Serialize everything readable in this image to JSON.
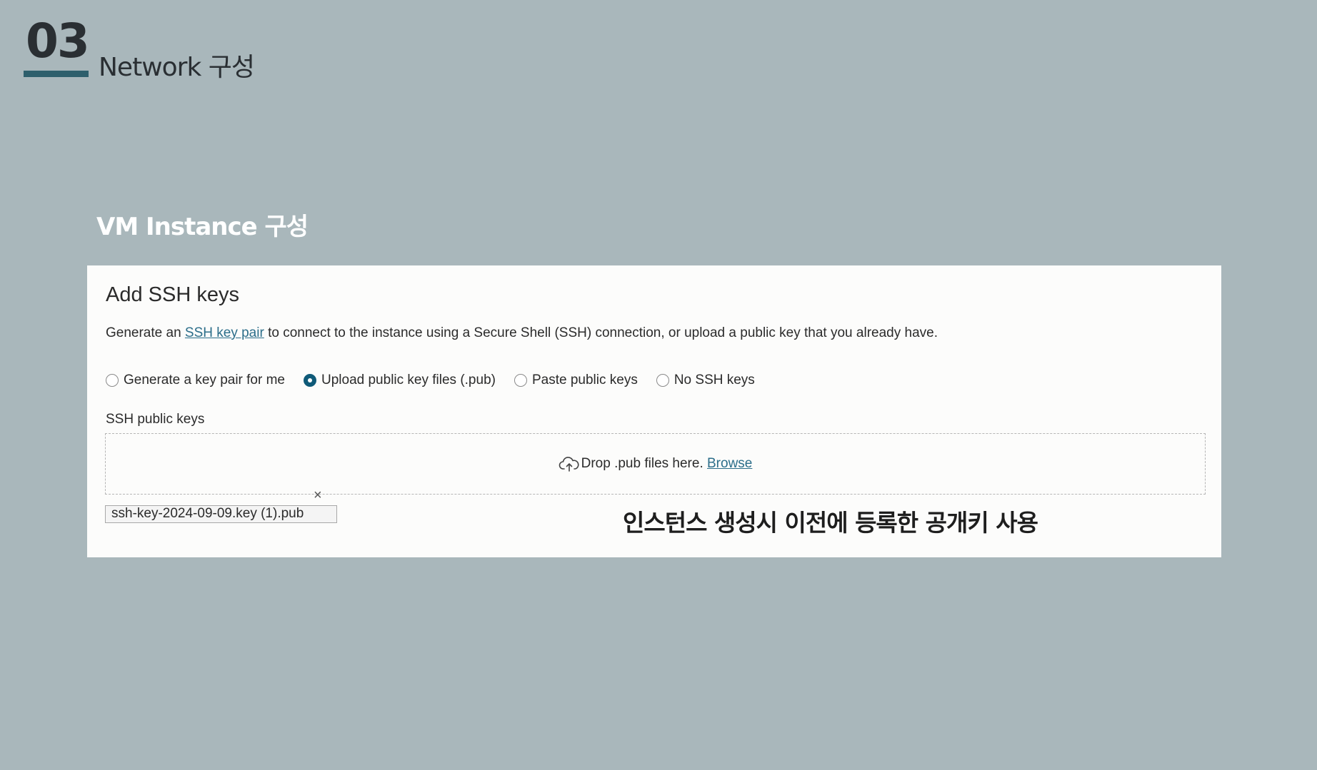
{
  "slide": {
    "section_number": "03",
    "section_title": "Network 구성",
    "subtitle": "VM Instance 구성",
    "accent_color": "#2e5f6c"
  },
  "panel": {
    "title": "Add SSH keys",
    "description": {
      "prefix": "Generate an ",
      "link": "SSH key pair",
      "suffix": " to connect to the instance using a Secure Shell (SSH) connection, or upload a public key that you already have."
    },
    "radio_options": [
      {
        "label": "Generate a key pair for me",
        "selected": false
      },
      {
        "label": "Upload public key files (.pub)",
        "selected": true
      },
      {
        "label": "Paste public keys",
        "selected": false
      },
      {
        "label": "No SSH keys",
        "selected": false
      }
    ],
    "field_label": "SSH public keys",
    "dropzone": {
      "icon": "cloud-upload-icon",
      "text": "Drop .pub files here.",
      "browse_link": "Browse"
    },
    "remove_icon": "×",
    "uploaded_file": "ssh-key-2024-09-09.key (1).pub"
  },
  "annotation": "인스턴스 생성시 이전에 등록한 공개키 사용"
}
